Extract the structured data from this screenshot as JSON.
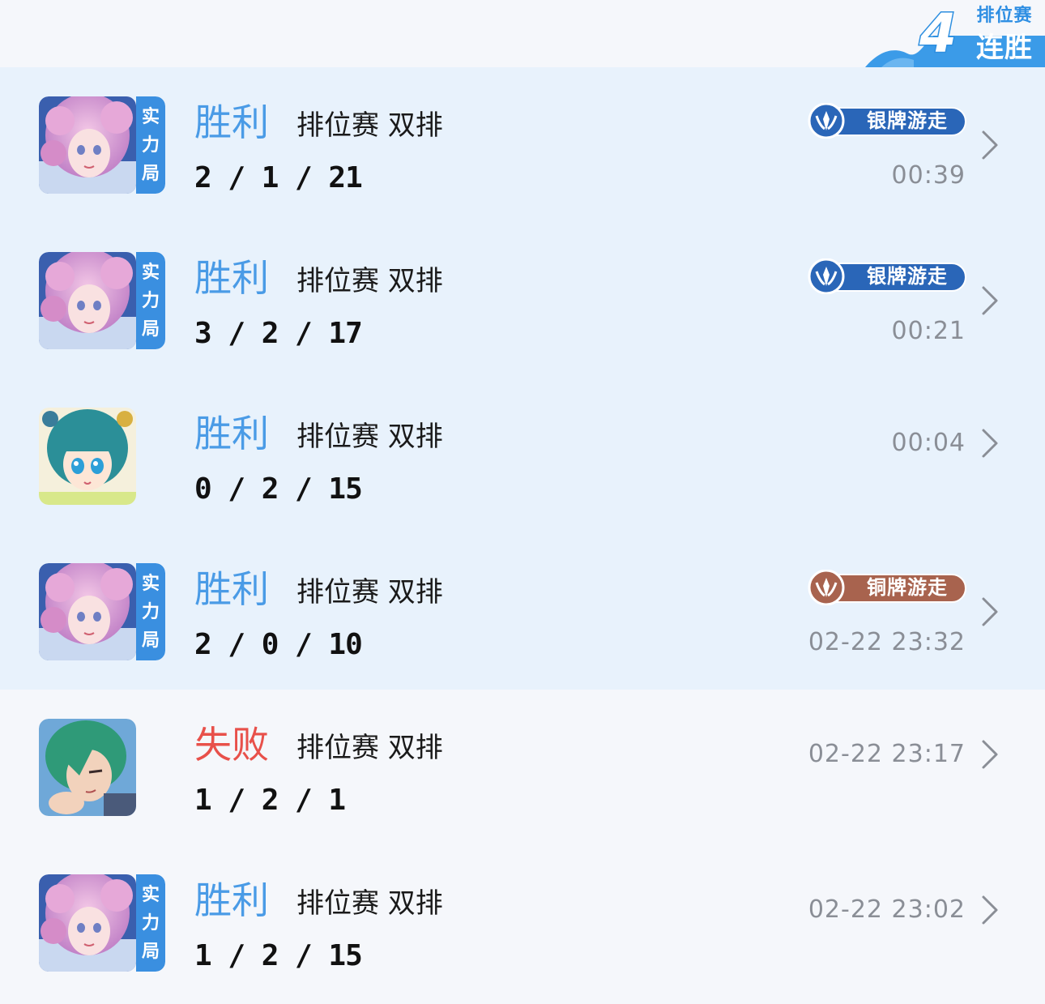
{
  "streak_badge": {
    "count": "4",
    "mode_label": "排位赛",
    "streak_label": "连胜"
  },
  "matches": [
    {
      "avatar_icon": "hero-pink-hair-portrait",
      "tag": [
        "实",
        "力",
        "局"
      ],
      "result": "胜利",
      "outcome": "win",
      "mode": "排位赛 双排",
      "kda": "2 / 1 / 21",
      "medal": {
        "label": "银牌游走",
        "tier": "silver",
        "color": "#2a66b8"
      },
      "time": "00:39",
      "highlighted": true
    },
    {
      "avatar_icon": "hero-pink-hair-portrait",
      "tag": [
        "实",
        "力",
        "局"
      ],
      "result": "胜利",
      "outcome": "win",
      "mode": "排位赛 双排",
      "kda": "3 / 2 / 17",
      "medal": {
        "label": "银牌游走",
        "tier": "silver",
        "color": "#2a66b8"
      },
      "time": "00:21",
      "highlighted": true
    },
    {
      "avatar_icon": "hero-teal-hair-portrait",
      "tag": null,
      "result": "胜利",
      "outcome": "win",
      "mode": "排位赛 双排",
      "kda": "0 / 2 / 15",
      "medal": null,
      "time": "00:04",
      "highlighted": true
    },
    {
      "avatar_icon": "hero-pink-hair-portrait",
      "tag": [
        "实",
        "力",
        "局"
      ],
      "result": "胜利",
      "outcome": "win",
      "mode": "排位赛 双排",
      "kda": "2 / 0 / 10",
      "medal": {
        "label": "铜牌游走",
        "tier": "bronze",
        "color": "#a8634e"
      },
      "time": "02-22 23:32",
      "highlighted": true
    },
    {
      "avatar_icon": "hero-green-hair-portrait",
      "tag": null,
      "result": "失败",
      "outcome": "loss",
      "mode": "排位赛 双排",
      "kda": "1 / 2 / 1",
      "medal": null,
      "time": "02-22 23:17",
      "highlighted": false
    },
    {
      "avatar_icon": "hero-pink-hair-portrait",
      "tag": [
        "实",
        "力",
        "局"
      ],
      "result": "胜利",
      "outcome": "win",
      "mode": "排位赛 双排",
      "kda": "1 / 2 / 15",
      "medal": null,
      "time": "02-22 23:02",
      "highlighted": false
    }
  ]
}
